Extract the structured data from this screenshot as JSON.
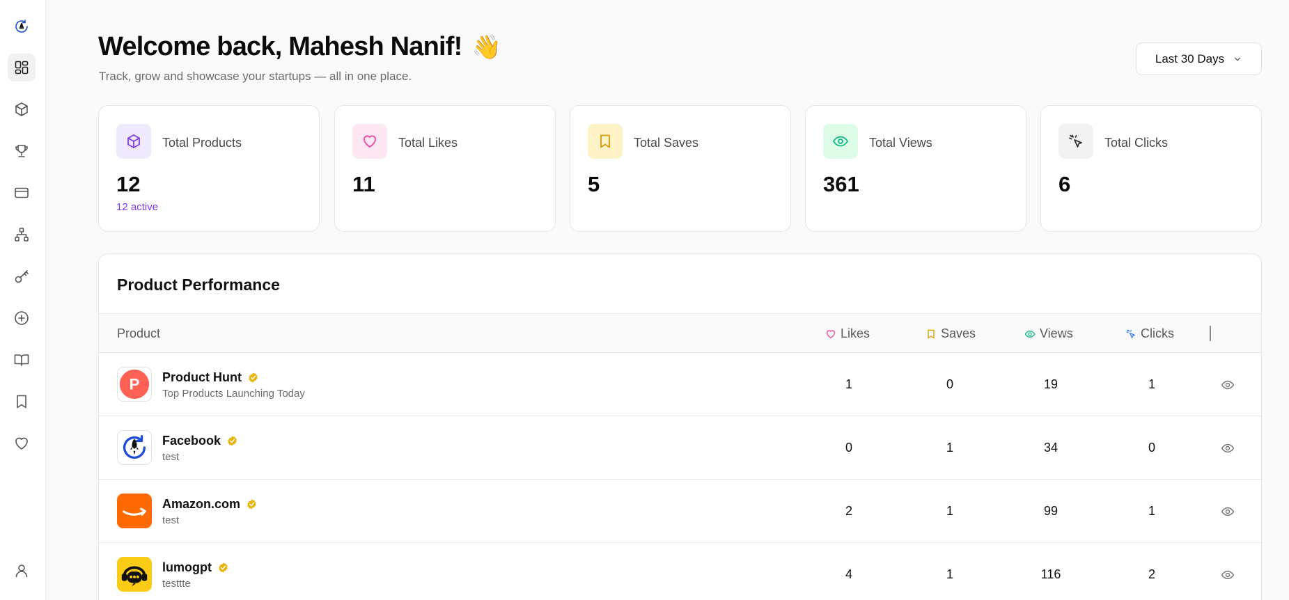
{
  "header": {
    "title": "Welcome back, Mahesh Nanif!",
    "emoji": "👋",
    "subtitle": "Track, grow and showcase your startups — all in one place.",
    "date_range": "Last 30 Days"
  },
  "sidebar": {
    "items": [
      {
        "icon": "logo-icon"
      },
      {
        "icon": "dashboard-icon",
        "active": true
      },
      {
        "icon": "box-icon"
      },
      {
        "icon": "trophy-icon"
      },
      {
        "icon": "credit-card-icon"
      },
      {
        "icon": "sitemap-icon"
      },
      {
        "icon": "key-icon"
      },
      {
        "icon": "plus-circle-icon"
      },
      {
        "icon": "book-open-icon"
      },
      {
        "icon": "bookmark-icon"
      },
      {
        "icon": "heart-icon"
      },
      {
        "icon": "user-icon"
      }
    ]
  },
  "stats": [
    {
      "label": "Total Products",
      "value": "12",
      "sub": "12 active",
      "icon": "box-icon",
      "color": "#7c3aed",
      "bg": "#efe9fd"
    },
    {
      "label": "Total Likes",
      "value": "11",
      "sub": "",
      "icon": "heart-icon",
      "color": "#ec4899",
      "bg": "#fde7f2"
    },
    {
      "label": "Total Saves",
      "value": "5",
      "sub": "",
      "icon": "bookmark-icon",
      "color": "#d99a06",
      "bg": "#fef3c7"
    },
    {
      "label": "Total Views",
      "value": "361",
      "sub": "",
      "icon": "eye-icon",
      "color": "#10b981",
      "bg": "#dcfce7"
    },
    {
      "label": "Total Clicks",
      "value": "6",
      "sub": "",
      "icon": "cursor-click-icon",
      "color": "#333333",
      "bg": "#f2f2f2"
    }
  ],
  "performance": {
    "title": "Product Performance",
    "columns": {
      "product": "Product",
      "likes": "Likes",
      "saves": "Saves",
      "views": "Views",
      "clicks": "Clicks"
    },
    "rows": [
      {
        "name": "Product Hunt",
        "desc": "Top Products Launching Today",
        "likes": "1",
        "saves": "0",
        "views": "19",
        "clicks": "1",
        "logo": "P"
      },
      {
        "name": "Facebook",
        "desc": "test",
        "likes": "0",
        "saves": "1",
        "views": "34",
        "clicks": "0",
        "logo": "rocket"
      },
      {
        "name": "Amazon.com",
        "desc": "test",
        "likes": "2",
        "saves": "1",
        "views": "99",
        "clicks": "1",
        "logo": "amazon"
      },
      {
        "name": "lumogpt",
        "desc": "testtte",
        "likes": "4",
        "saves": "1",
        "views": "116",
        "clicks": "2",
        "logo": "lumo"
      }
    ]
  },
  "colors": {
    "accent_purple": "#7c3aed",
    "likes_pink": "#ec4899",
    "saves_amber": "#d99a06",
    "views_green": "#10b981",
    "clicks_blue": "#3b82f6",
    "verified_gold": "#eab308"
  }
}
